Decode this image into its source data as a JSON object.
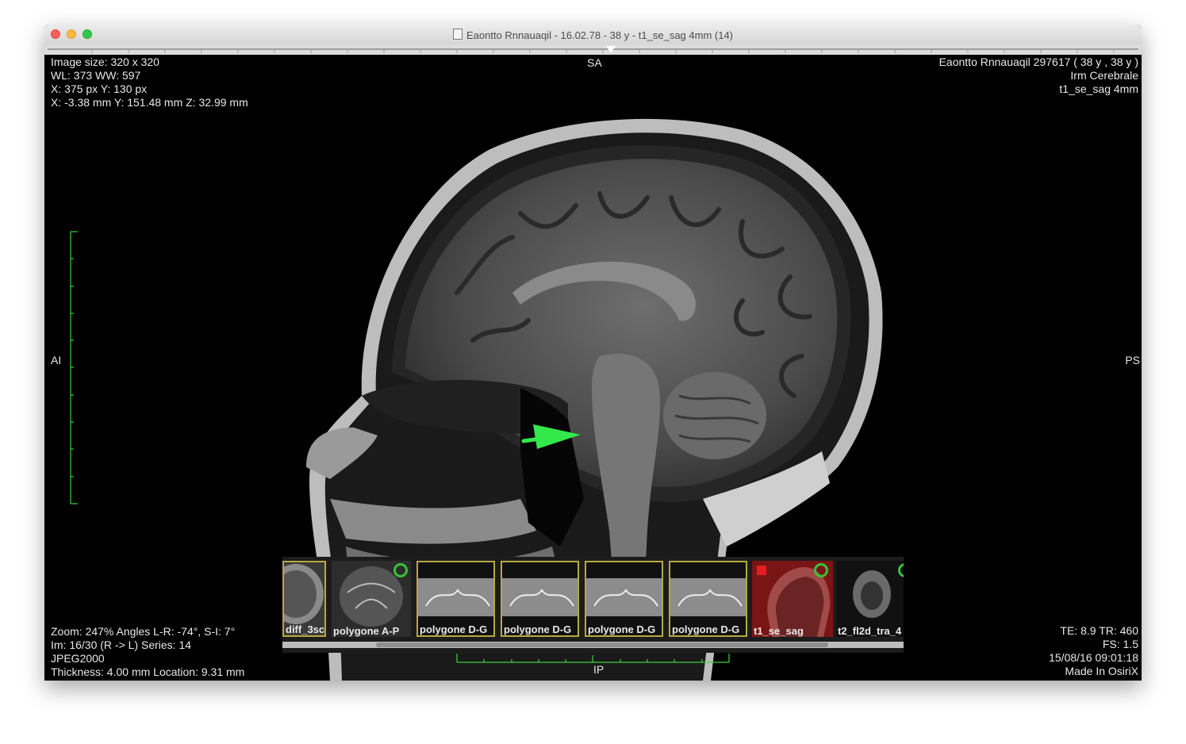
{
  "window": {
    "title": "Eaontto Rnnauaqil - 16.02.78 - 38 y - t1_se_sag 4mm (14)"
  },
  "overlay": {
    "top_left": [
      "Image size: 320 x 320",
      "WL: 373 WW: 597",
      "X: 375 px Y: 130 px",
      "X: -3.38 mm Y: 151.48 mm Z: 32.99 mm"
    ],
    "top_right": [
      "Eaontto Rnnauaqil 297617 (  38 y ,  38 y )",
      "Irm Cerebrale",
      "t1_se_sag 4mm"
    ],
    "bottom_left": [
      "Zoom: 247% Angles L-R: -74°, S-I: 7°",
      "Im: 16/30  (R -> L) Series:  14",
      "JPEG2000",
      "Thickness: 4.00 mm Location: 9.31 mm"
    ],
    "bottom_right": [
      "TE:  8.9 TR:  460",
      "FS:  1.5",
      "15/08/16 09:01:18",
      "Made In OsiriX"
    ],
    "orientation": {
      "top": "SA",
      "left": "AI",
      "right": "PS",
      "bottom": "IP"
    }
  },
  "thumbnails": [
    {
      "label": "diff_3sc",
      "selected": false
    },
    {
      "label": "polygone A-P",
      "selected": false
    },
    {
      "label": "polygone D-G",
      "selected": false
    },
    {
      "label": "polygone D-G",
      "selected": false
    },
    {
      "label": "polygone D-G",
      "selected": false
    },
    {
      "label": "polygone D-G",
      "selected": false
    },
    {
      "label": "t1_se_sag",
      "selected": true
    },
    {
      "label": "t2_fl2d_tra_4",
      "selected": false
    }
  ],
  "colors": {
    "annotation_arrow": "#33e84a",
    "scale_bar": "#3cd23c",
    "selected_thumb": "#7a1515"
  }
}
